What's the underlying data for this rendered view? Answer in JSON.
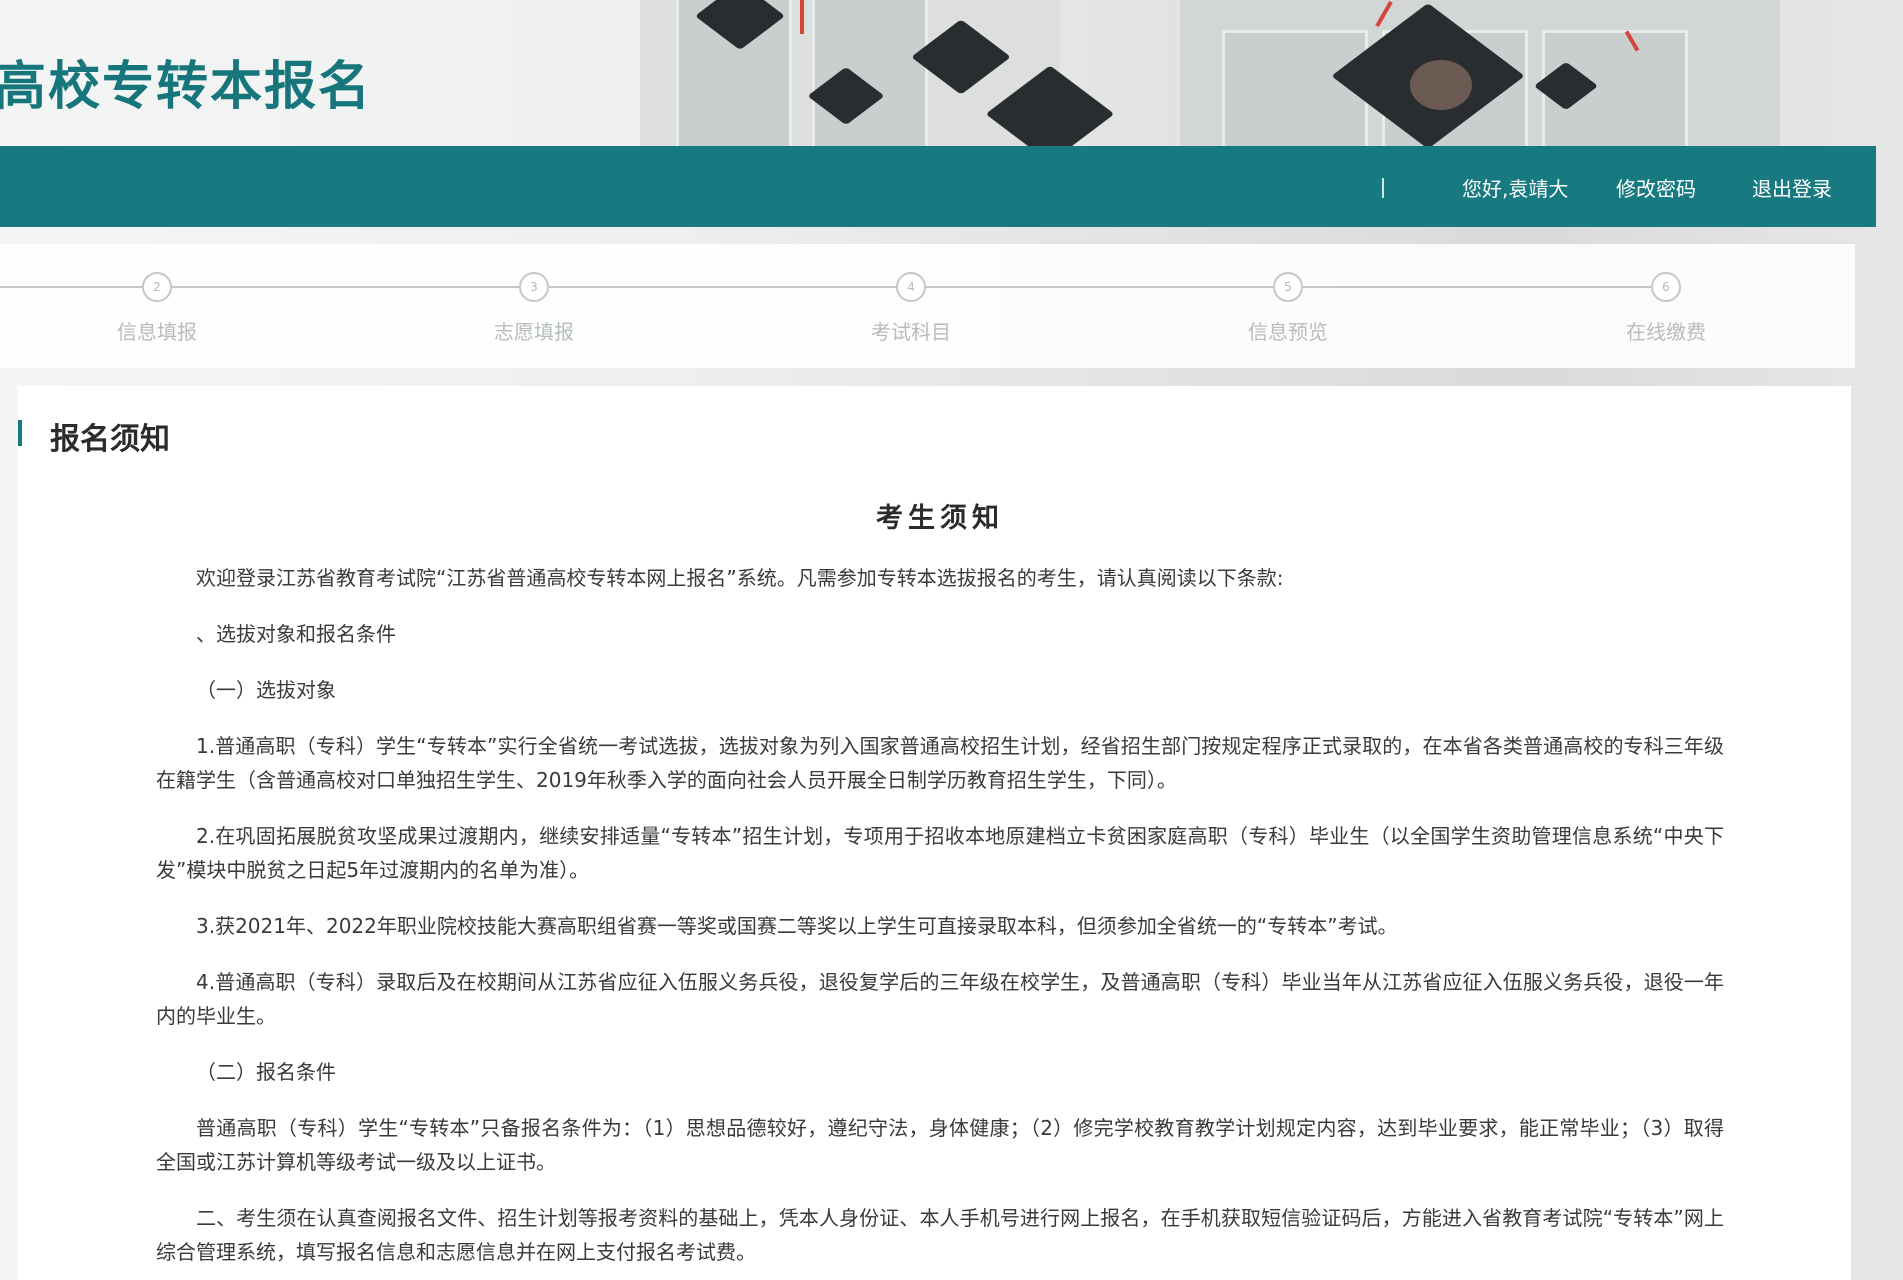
{
  "header": {
    "title": "高校专转本报名"
  },
  "nav": {
    "greeting": "您好,袁靖大",
    "change_password": "修改密码",
    "logout": "退出登录"
  },
  "steps": [
    {
      "num": "2",
      "label": "信息填报"
    },
    {
      "num": "3",
      "label": "志愿填报"
    },
    {
      "num": "4",
      "label": "考试科目"
    },
    {
      "num": "5",
      "label": "信息预览"
    },
    {
      "num": "6",
      "label": "在线缴费"
    }
  ],
  "notice": {
    "section_title": "报名须知",
    "doc_title": "考生须知",
    "intro": "欢迎登录江苏省教育考试院“江苏省普通高校专转本网上报名”系统。凡需参加专转本选拔报名的考生，请认真阅读以下条款:",
    "heading_1": "、选拔对象和报名条件",
    "sub_1": "（一）选拔对象",
    "item_1": "1.普通高职（专科）学生“专转本”实行全省统一考试选拔，选拔对象为列入国家普通高校招生计划，经省招生部门按规定程序正式录取的，在本省各类普通高校的专科三年级在籍学生（含普通高校对口单独招生学生、2019年秋季入学的面向社会人员开展全日制学历教育招生学生，下同）。",
    "item_2": "2.在巩固拓展脱贫攻坚成果过渡期内，继续安排适量“专转本”招生计划，专项用于招收本地原建档立卡贫困家庭高职（专科）毕业生（以全国学生资助管理信息系统“中央下发”模块中脱贫之日起5年过渡期内的名单为准）。",
    "item_3": "3.获2021年、2022年职业院校技能大赛高职组省赛一等奖或国赛二等奖以上学生可直接录取本科，但须参加全省统一的“专转本”考试。",
    "item_4": "4.普通高职（专科）录取后及在校期间从江苏省应征入伍服义务兵役，退役复学后的三年级在校学生，及普通高职（专科）毕业当年从江苏省应征入伍服义务兵役，退役一年内的毕业生。",
    "sub_2": "（二）报名条件",
    "conditions": "普通高职（专科）学生“专转本”只备报名条件为：（1）思想品德较好，遵纪守法，身体健康；（2）修完学校教育教学计划规定内容，达到毕业要求，能正常毕业；（3）取得全国或江苏计算机等级考试一级及以上证书。",
    "heading_2": "二、考生须在认真查阅报名文件、招生计划等报考资料的基础上，凭本人身份证、本人手机号进行网上报名，在手机获取短信验证码后，方能进入省教育考试院“专转本”网上综合管理系统，填写报名信息和志愿信息并在网上支付报名考试费。"
  }
}
